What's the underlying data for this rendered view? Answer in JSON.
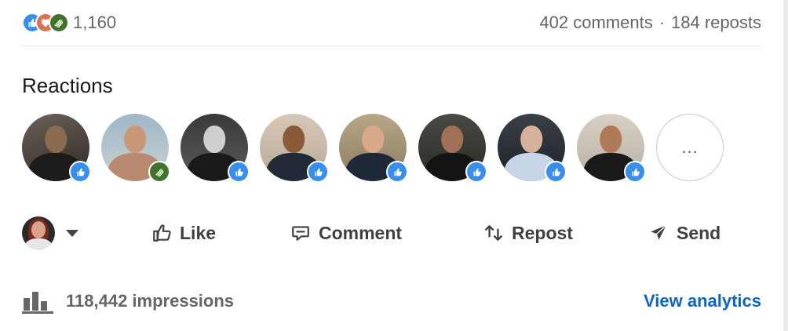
{
  "social_counts": {
    "reaction_count": "1,160",
    "comments": "402 comments",
    "separator": "·",
    "reposts": "184 reposts",
    "reaction_types": [
      "like-icon",
      "love-icon",
      "support-icon"
    ]
  },
  "reactions": {
    "title": "Reactions",
    "more_label": "…",
    "people": [
      {
        "reaction": "like"
      },
      {
        "reaction": "support"
      },
      {
        "reaction": "like"
      },
      {
        "reaction": "like"
      },
      {
        "reaction": "like"
      },
      {
        "reaction": "like"
      },
      {
        "reaction": "like"
      },
      {
        "reaction": "like"
      }
    ]
  },
  "actions": {
    "like": "Like",
    "comment": "Comment",
    "repost": "Repost",
    "send": "Send"
  },
  "analytics": {
    "impressions": "118,442 impressions",
    "view_link": "View analytics"
  },
  "colors": {
    "like_blue": "#378fe9",
    "love_red": "#df704d",
    "support_green": "#44712e",
    "link_blue": "#0a66c2"
  }
}
